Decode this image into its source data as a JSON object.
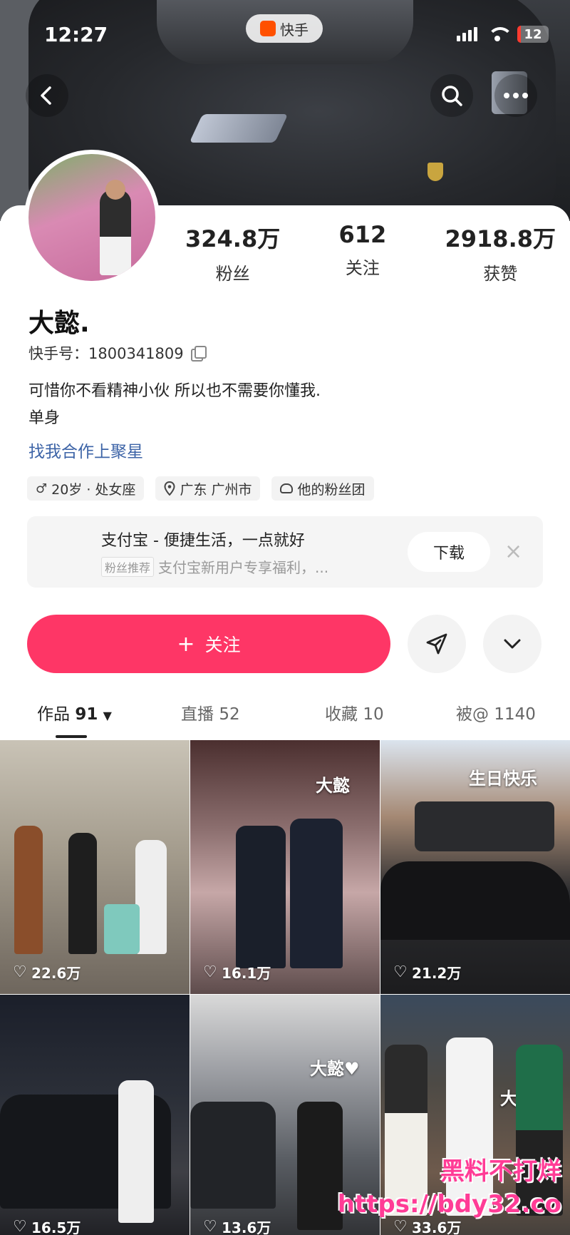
{
  "status_bar": {
    "time": "12:27",
    "app_name": "快手",
    "battery_level": "12",
    "battery_fraction": 0.12
  },
  "header": {
    "back_icon": "chevron-left-icon",
    "search_icon": "search-icon",
    "more_icon": "more-icon"
  },
  "profile": {
    "followers_count": "324.8万",
    "followers_label": "粉丝",
    "following_count": "612",
    "following_label": "关注",
    "likes_count": "2918.8万",
    "likes_label": "获赞",
    "name": "大懿.",
    "kuaishou_id": "快手号：1800341809",
    "bio_line1": "可惜你不看精神小伙  所以也不需要你懂我.",
    "bio_line2": "单身",
    "cooperate_link": "找我合作上聚星",
    "tags": {
      "age": "20岁 · 处女座",
      "location": "广东 广州市",
      "fan_group": "他的粉丝团"
    }
  },
  "ad": {
    "title": "支付宝 - 便捷生活，一点就好",
    "chip": "粉丝推荐",
    "subtitle": "支付宝新用户专享福利，...",
    "download_label": "下载",
    "close_label": "×"
  },
  "actions": {
    "follow_label": "关注",
    "plus": "+"
  },
  "tabs": [
    {
      "label": "作品",
      "count": "91"
    },
    {
      "label": "直播",
      "count": "52"
    },
    {
      "label": "收藏",
      "count": "10"
    },
    {
      "label": "被@",
      "count": "1140"
    }
  ],
  "videos": [
    {
      "likes": "22.6万",
      "caption": ""
    },
    {
      "likes": "16.1万",
      "caption": "大懿"
    },
    {
      "likes": "21.2万",
      "caption": "生日快乐"
    },
    {
      "likes": "16.5万",
      "caption": ""
    },
    {
      "likes": "13.6万",
      "caption": "大懿♥"
    },
    {
      "likes": "33.6万",
      "caption": "大懿♥"
    }
  ],
  "watermark": {
    "line1": "黑料不打烊",
    "line2": "https://bdy32.co"
  },
  "colors": {
    "follow_button": "#fe3666",
    "link": "#3d64a7",
    "app_logo": "#ff5000"
  }
}
